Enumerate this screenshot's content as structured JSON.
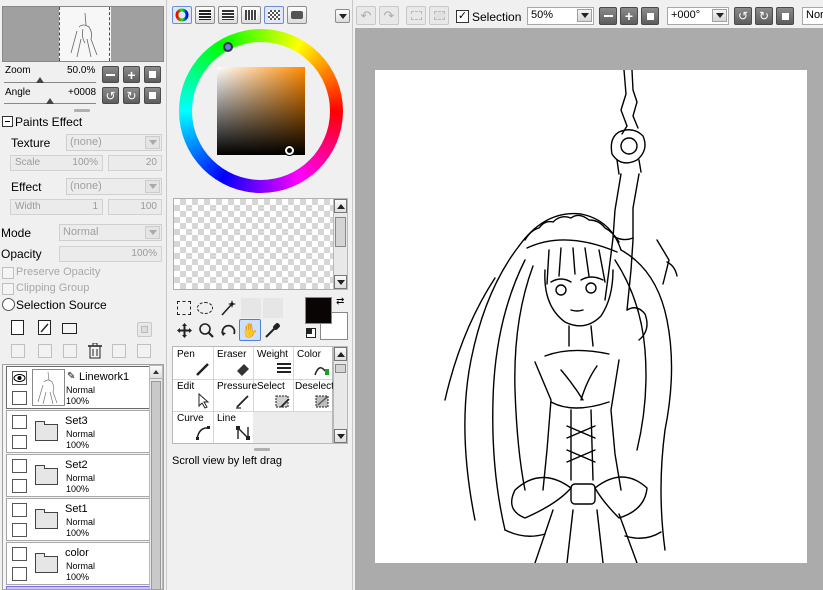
{
  "navigator": {
    "zoom_label": "Zoom",
    "zoom_value": "50.0%",
    "angle_label": "Angle",
    "angle_value": "+0008"
  },
  "paints_effect": {
    "title": "Paints Effect",
    "texture_label": "Texture",
    "texture_value": "(none)",
    "scale_label": "Scale",
    "scale_value": "100%",
    "scale_num": "20",
    "effect_label": "Effect",
    "effect_value": "(none)",
    "width_label": "Width",
    "width_value": "1",
    "width_num": "100"
  },
  "layer_props": {
    "mode_label": "Mode",
    "mode_value": "Normal",
    "opacity_label": "Opacity",
    "opacity_value": "100%",
    "preserve_opacity": "Preserve Opacity",
    "clipping_group": "Clipping Group",
    "selection_source": "Selection Source"
  },
  "layers": [
    {
      "name": "Linework1",
      "mode": "Normal",
      "opacity": "100%",
      "type": "pen"
    },
    {
      "name": "Set3",
      "mode": "Normal",
      "opacity": "100%",
      "type": "folder"
    },
    {
      "name": "Set2",
      "mode": "Normal",
      "opacity": "100%",
      "type": "folder"
    },
    {
      "name": "Set1",
      "mode": "Normal",
      "opacity": "100%",
      "type": "folder"
    },
    {
      "name": "color",
      "mode": "Normal",
      "opacity": "100%",
      "type": "folder"
    }
  ],
  "tools": [
    {
      "name": "Pen"
    },
    {
      "name": "Eraser"
    },
    {
      "name": "Weight"
    },
    {
      "name": "Color"
    },
    {
      "name": "Edit"
    },
    {
      "name": "Pressure"
    },
    {
      "name": "Select"
    },
    {
      "name": "Deselect"
    },
    {
      "name": "Curve"
    },
    {
      "name": "Line"
    }
  ],
  "status": {
    "hint": "Scroll view by left drag"
  },
  "toolbar": {
    "selection_label": "Selection",
    "zoom_value": "50%",
    "angle_value": "+000°",
    "blend_value": "Nor"
  },
  "colors": {
    "primary": "#0a0505",
    "secondary": "#ffffff",
    "panel_bg": "#f0f0f0",
    "canvas_bg": "#ababab"
  }
}
